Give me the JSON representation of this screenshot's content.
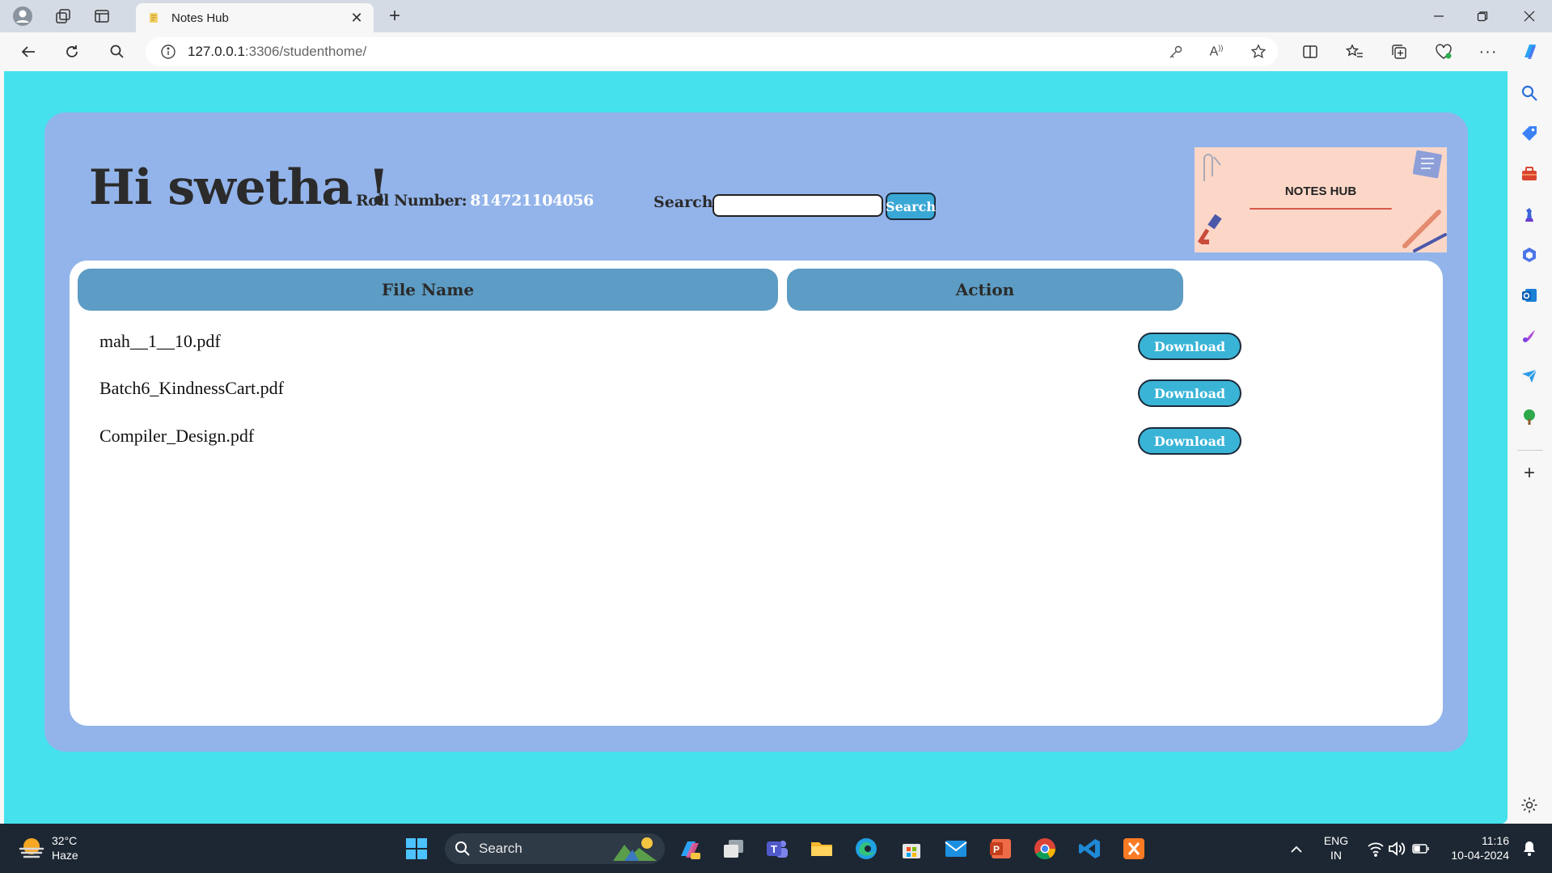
{
  "browser": {
    "tab_title": "Notes Hub",
    "url_host": "127.0.0.1",
    "url_rest": ":3306/studenthome/"
  },
  "page": {
    "greeting": "Hi swetha !",
    "roll_label": "Roll Number:",
    "roll_value": "814721104056",
    "search_label": "Search:",
    "search_value": "",
    "search_button": "Search",
    "banner_title": "NOTES HUB",
    "table": {
      "headers": [
        "File Name",
        "Action"
      ],
      "rows": [
        {
          "file": "mah__1__10.pdf",
          "action": "Download"
        },
        {
          "file": "Batch6_KindnessCart.pdf",
          "action": "Download"
        },
        {
          "file": "Compiler_Design.pdf",
          "action": "Download"
        }
      ]
    }
  },
  "colors": {
    "page_bg": "#45e1ec",
    "card_bg": "#93b4ea",
    "header_cell": "#5d9cc4",
    "download_btn": "#3ab4d6"
  },
  "taskbar": {
    "weather_temp": "32°C",
    "weather_desc": "Haze",
    "search_placeholder": "Search",
    "lang_top": "ENG",
    "lang_bottom": "IN",
    "time": "11:16",
    "date": "10-04-2024"
  }
}
